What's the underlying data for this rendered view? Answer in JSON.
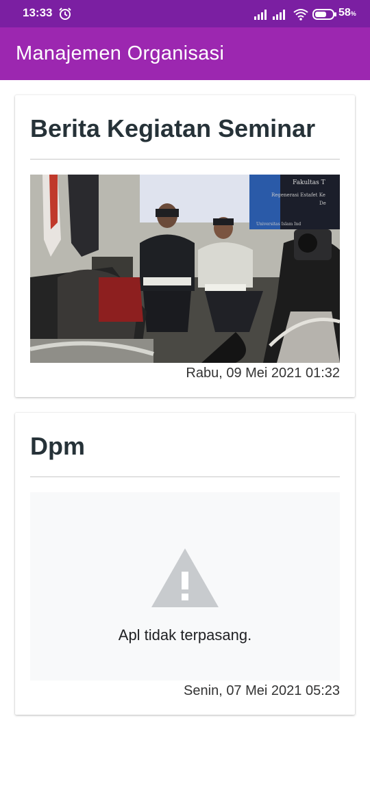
{
  "status_bar": {
    "time": "13:33",
    "battery_percent": "58",
    "battery_unit": "%",
    "icons": [
      "alarm-icon",
      "signal-icon",
      "signal-icon",
      "wifi-icon",
      "battery-icon"
    ]
  },
  "app_bar": {
    "title": "Manajemen Organisasi",
    "color": "#9c27b0"
  },
  "cards": [
    {
      "title": "Berita Kegiatan Seminar",
      "date": "Rabu, 09 Mei 2021 01:32",
      "media": "photo",
      "photo_text": {
        "line1": "Fakultas T",
        "line2": "Regenerasi Estafet Ke",
        "line3": "De",
        "line4": "Universitas Islam Ind"
      }
    },
    {
      "title": "Dpm",
      "date": "Senin, 07 Mei 2021 05:23",
      "media": "error",
      "error_text": "Apl tidak terpasang.",
      "error_icon": "warning-icon"
    }
  ]
}
